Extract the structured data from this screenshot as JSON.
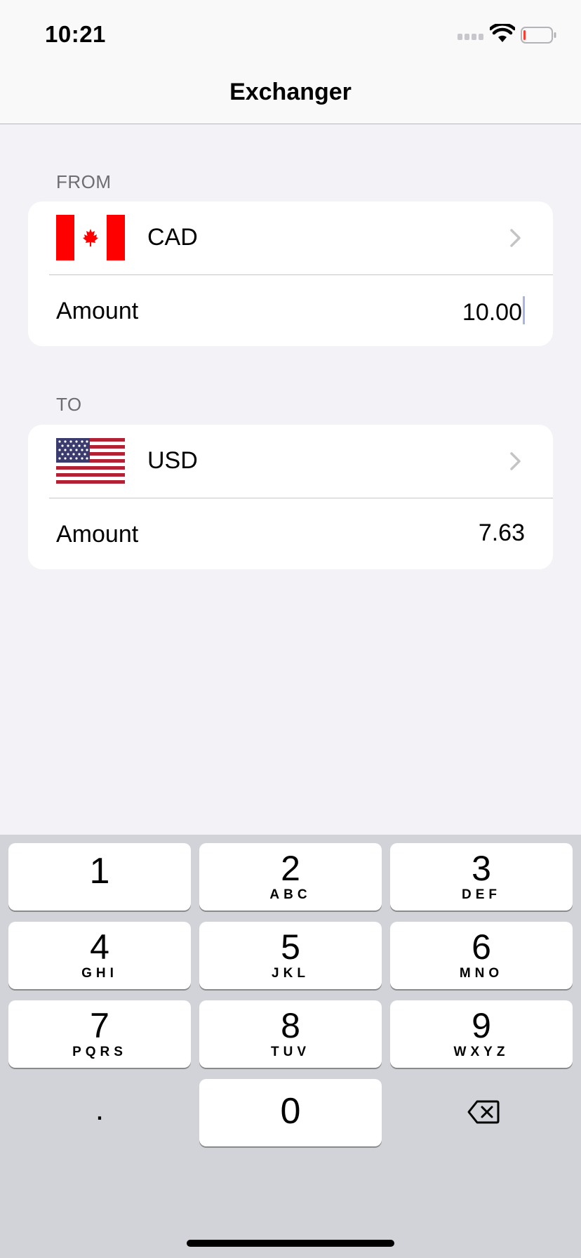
{
  "status_bar": {
    "time": "10:21"
  },
  "nav": {
    "title": "Exchanger"
  },
  "from": {
    "header": "FROM",
    "currency": "CAD",
    "amount_label": "Amount",
    "amount_value": "10.00"
  },
  "to": {
    "header": "TO",
    "currency": "USD",
    "amount_label": "Amount",
    "amount_value": "7.63"
  },
  "keyboard": {
    "keys": [
      {
        "digit": "1",
        "letters": ""
      },
      {
        "digit": "2",
        "letters": "ABC"
      },
      {
        "digit": "3",
        "letters": "DEF"
      },
      {
        "digit": "4",
        "letters": "GHI"
      },
      {
        "digit": "5",
        "letters": "JKL"
      },
      {
        "digit": "6",
        "letters": "MNO"
      },
      {
        "digit": "7",
        "letters": "PQRS"
      },
      {
        "digit": "8",
        "letters": "TUV"
      },
      {
        "digit": "9",
        "letters": "WXYZ"
      }
    ],
    "zero": "0",
    "decimal": "."
  },
  "colors": {
    "canada_red": "#ff0000",
    "us_red": "#b22234",
    "us_blue": "#3c3b6e",
    "caret": "#a8b3e6",
    "background": "#f2f2f7"
  },
  "icons": [
    "canada-flag-icon",
    "us-flag-icon",
    "chevron-right-icon",
    "backspace-icon",
    "wifi-icon",
    "battery-icon",
    "signal-icon"
  ]
}
